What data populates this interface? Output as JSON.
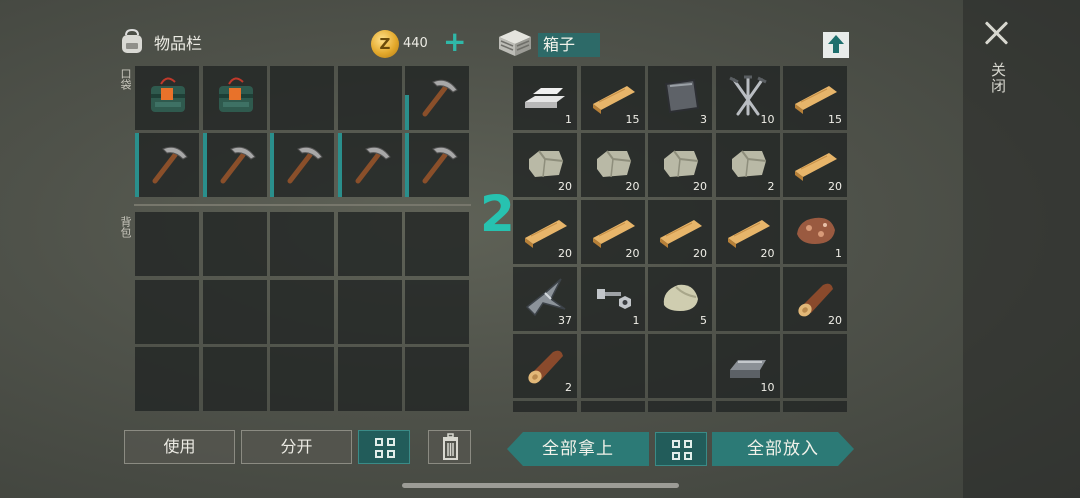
{
  "inventory": {
    "title": "物品栏",
    "currency_amount": "440",
    "coin_letter": "Z",
    "pocket_label": "口袋",
    "backpack_label": "背包",
    "pocket_slots": [
      {
        "item": "explosive-pack",
        "qty": ""
      },
      {
        "item": "explosive-pack",
        "qty": ""
      },
      {
        "item": "",
        "qty": ""
      },
      {
        "item": "",
        "qty": ""
      },
      {
        "item": "pickaxe",
        "qty": "",
        "durability": 0.55
      },
      {
        "item": "pickaxe",
        "qty": "",
        "durability": 1.0
      },
      {
        "item": "pickaxe",
        "qty": "",
        "durability": 1.0
      },
      {
        "item": "pickaxe",
        "qty": "",
        "durability": 1.0
      },
      {
        "item": "pickaxe",
        "qty": "",
        "durability": 1.0
      },
      {
        "item": "pickaxe",
        "qty": "",
        "durability": 1.0
      }
    ],
    "backpack_slots": 15,
    "use_label": "使用",
    "split_label": "分开"
  },
  "chest": {
    "title": "箱子",
    "marker": "2",
    "slots": [
      {
        "item": "metal-ingots",
        "qty": "1"
      },
      {
        "item": "wood-plank",
        "qty": "15"
      },
      {
        "item": "iron-plate",
        "qty": "3"
      },
      {
        "item": "nails",
        "qty": "10"
      },
      {
        "item": "wood-plank",
        "qty": "15"
      },
      {
        "item": "stone",
        "qty": "20"
      },
      {
        "item": "stone",
        "qty": "20"
      },
      {
        "item": "stone",
        "qty": "20"
      },
      {
        "item": "stone",
        "qty": "2"
      },
      {
        "item": "wood-plank",
        "qty": "20"
      },
      {
        "item": "wood-plank",
        "qty": "20"
      },
      {
        "item": "wood-plank",
        "qty": "20"
      },
      {
        "item": "wood-plank",
        "qty": "20"
      },
      {
        "item": "wood-plank",
        "qty": "20"
      },
      {
        "item": "copper-ore",
        "qty": "1"
      },
      {
        "item": "scrap-metal",
        "qty": "37"
      },
      {
        "item": "bolt-nut",
        "qty": "1"
      },
      {
        "item": "rock",
        "qty": "5"
      },
      {
        "item": "",
        "qty": ""
      },
      {
        "item": "log",
        "qty": "20"
      },
      {
        "item": "log",
        "qty": "2"
      },
      {
        "item": "",
        "qty": ""
      },
      {
        "item": "",
        "qty": ""
      },
      {
        "item": "iron-ingot",
        "qty": "10"
      },
      {
        "item": "",
        "qty": ""
      }
    ],
    "take_all_label": "全部拿上",
    "put_all_label": "全部放入"
  },
  "close_label": "关闭",
  "colors": {
    "accent": "#2c7a76",
    "marker": "#27c2b0",
    "durability": "#2a8f8c"
  }
}
